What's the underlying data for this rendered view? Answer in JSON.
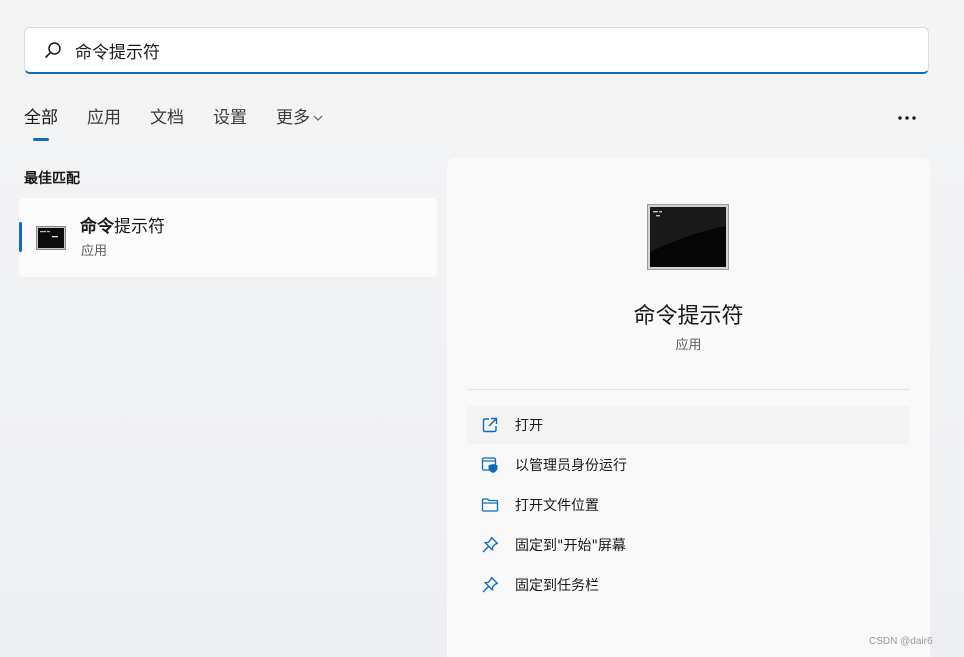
{
  "search": {
    "value": "命令提示符"
  },
  "tabs": [
    {
      "label": "全部"
    },
    {
      "label": "应用"
    },
    {
      "label": "文档"
    },
    {
      "label": "设置"
    },
    {
      "label": "更多"
    }
  ],
  "best_match": {
    "section_title": "最佳匹配",
    "item": {
      "title_bold": "命令",
      "title_rest": "提示符",
      "subtitle": "应用"
    }
  },
  "detail": {
    "title": "命令提示符",
    "subtitle": "应用",
    "actions": [
      {
        "label": "打开",
        "icon": "open-external-icon"
      },
      {
        "label": "以管理员身份运行",
        "icon": "run-as-admin-icon"
      },
      {
        "label": "打开文件位置",
        "icon": "folder-icon"
      },
      {
        "label": "固定到\"开始\"屏幕",
        "icon": "pin-icon"
      },
      {
        "label": "固定到任务栏",
        "icon": "pin-icon"
      }
    ]
  },
  "colors": {
    "accent": "#0f6cbd"
  },
  "watermark": "CSDN @dair6"
}
